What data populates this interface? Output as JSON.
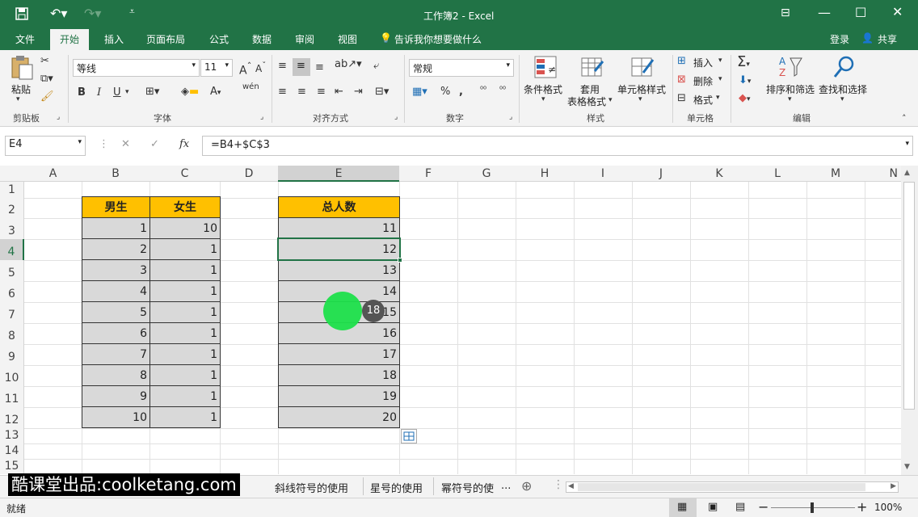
{
  "window": {
    "title": "工作簿2 - Excel"
  },
  "ribbon_tabs": [
    "文件",
    "开始",
    "插入",
    "页面布局",
    "公式",
    "数据",
    "审阅",
    "视图"
  ],
  "tell_me": "告诉我你想要做什么",
  "signin": "登录",
  "share": "共享",
  "clipboard": {
    "paste": "粘贴",
    "group": "剪贴板"
  },
  "font": {
    "name": "等线",
    "size": "11",
    "bold": "B",
    "italic": "I",
    "underline": "U",
    "group": "字体",
    "phonetic": "wén"
  },
  "alignment": {
    "group": "对齐方式"
  },
  "number": {
    "format": "常规",
    "group": "数字",
    "percent": "%"
  },
  "styles": {
    "conditional": "条件格式",
    "table": "套用",
    "table2": "表格格式",
    "cell": "单元格样式",
    "group": "样式"
  },
  "cells": {
    "insert": "插入",
    "delete": "删除",
    "format": "格式",
    "group": "单元格"
  },
  "editing": {
    "sort": "排序和筛选",
    "find": "查找和选择",
    "group": "编辑"
  },
  "formula_bar": {
    "name_box": "E4",
    "fx": "fx",
    "formula": "=B4+$C$3"
  },
  "columns": [
    "A",
    "B",
    "C",
    "D",
    "E",
    "F",
    "G",
    "H",
    "I",
    "J",
    "K",
    "L",
    "M",
    "N"
  ],
  "rows": [
    "1",
    "2",
    "3",
    "4",
    "5",
    "6",
    "7",
    "8",
    "9",
    "10",
    "11",
    "12",
    "13",
    "14",
    "15"
  ],
  "table": {
    "b_header": "男生",
    "c_header": "女生",
    "e_header": "总人数",
    "b_values": [
      "1",
      "2",
      "3",
      "4",
      "5",
      "6",
      "7",
      "8",
      "9",
      "10"
    ],
    "c_values": [
      "10",
      "1",
      "1",
      "1",
      "1",
      "1",
      "1",
      "1",
      "1",
      "1"
    ],
    "e_values": [
      "11",
      "12",
      "13",
      "14",
      "15",
      "16",
      "17",
      "18",
      "19",
      "20"
    ]
  },
  "cursor_badge": "18",
  "sheet_tabs": [
    "斜线符号的使用",
    "星号的使用",
    "幂符号的使"
  ],
  "watermark": "酷课堂出品:coolketang.com",
  "status": {
    "ready": "就绪",
    "zoom": "100%"
  }
}
